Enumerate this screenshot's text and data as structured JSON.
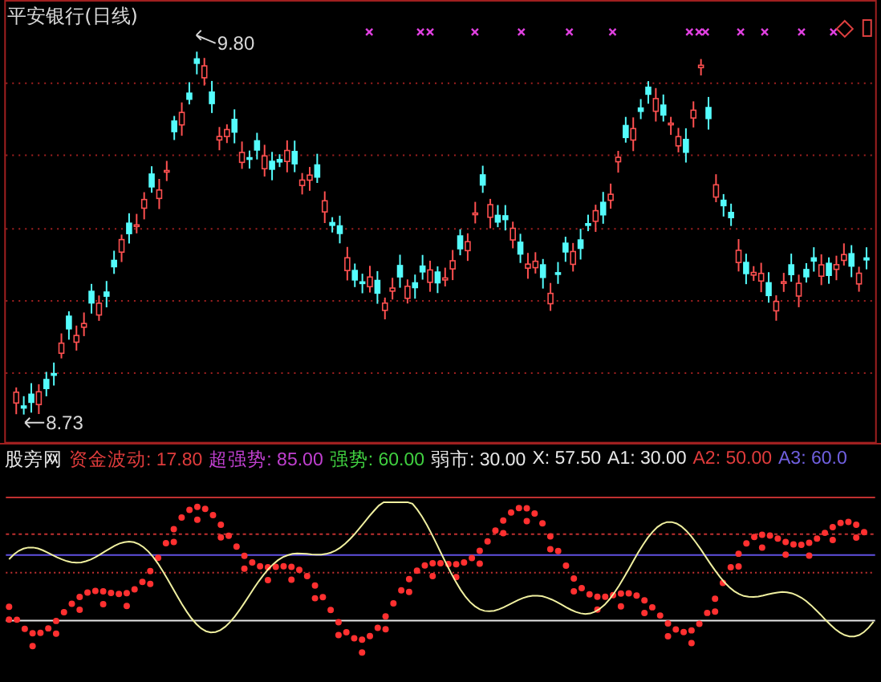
{
  "chart": {
    "title": "平安银行(日线)",
    "high_label": "9.80",
    "low_label": "8.73"
  },
  "indicator": {
    "name": "股旁网",
    "legend": [
      {
        "text": "资金波动: 17.80",
        "color": "#e03c3c"
      },
      {
        "text": "超强势: 85.00",
        "color": "#c040d0"
      },
      {
        "text": "强势: 60.00",
        "color": "#40d040"
      },
      {
        "text": "弱市: 30.00",
        "color": "#e8e8e8"
      },
      {
        "text": "X: 57.50",
        "color": "#e8e8e8"
      },
      {
        "text": "A1: 30.00",
        "color": "#e8e8e8"
      },
      {
        "text": "A2: 50.00",
        "color": "#e03c3c"
      },
      {
        "text": "A3: 60.0",
        "color": "#7060e0"
      }
    ]
  }
}
